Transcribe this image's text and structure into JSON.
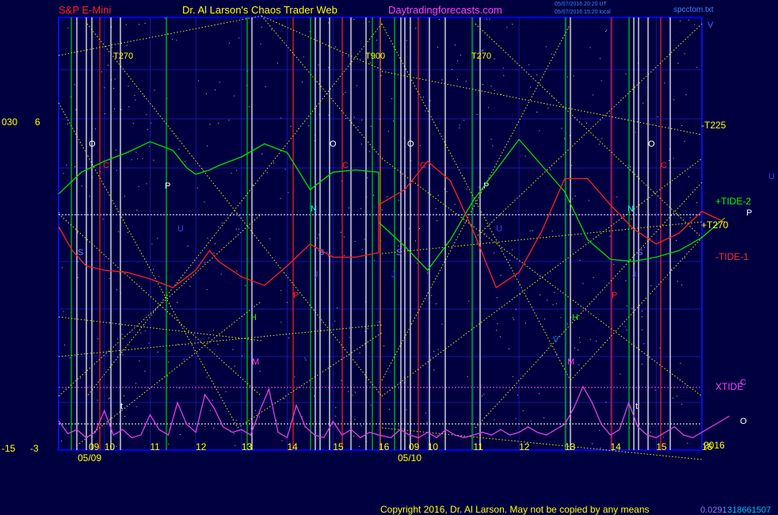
{
  "header": {
    "symbol": "S&P E-Mini",
    "title": "Dr. Al Larson's Chaos Trader Web",
    "site": "Daytradingforecasts.com",
    "timestamp_ut": "05/07/2016 20:20 UT",
    "timestamp_local": "05/07/2016 15:20 local",
    "file": "spcctom.txt"
  },
  "footer": {
    "copyright": "Copyright 2016, Dr. Al Larson. May not be copied by any means",
    "code_left": "0.0291",
    "code_right": "318661507"
  },
  "left_axis": {
    "top_a": "030",
    "top_b": "6",
    "bottom_a": "-15",
    "bottom_b": "-3"
  },
  "right_labels": {
    "v": "V",
    "u": "U",
    "p": "P",
    "o": "O",
    "c": "C",
    "t225": "-T225",
    "tide2": "+TIDE-2",
    "t270": "+T270",
    "tide1": "-TIDE-1",
    "xtide": "XTIDE",
    "year": "2016"
  },
  "x_axis": {
    "hours_day1": [
      "09",
      "10",
      "11",
      "12",
      "13",
      "14",
      "15",
      "16"
    ],
    "hours_day2": [
      "09",
      "10",
      "11",
      "12",
      "13",
      "14",
      "15",
      "16"
    ],
    "date_day1": "05/09",
    "date_day2": "05/10"
  },
  "chart_data": {
    "type": "line",
    "days": [
      "05/09",
      "05/10"
    ],
    "session_hours": [
      9,
      16
    ],
    "y_range": [
      -3,
      6
    ],
    "xtide_range": [
      -15,
      30
    ],
    "series": [
      {
        "name": "+TIDE-2",
        "color": "#00e000",
        "x": [
          9.0,
          9.5,
          10.0,
          10.5,
          11.0,
          11.5,
          11.8,
          12.0,
          12.3,
          12.5,
          13.0,
          13.5,
          14.0,
          14.5,
          15.0,
          15.5,
          16.0,
          16.0,
          16.5,
          17.0,
          17.5,
          18.0,
          18.5,
          19.0,
          19.5,
          20.0,
          20.5,
          21.0,
          21.5,
          22.0,
          22.5,
          23.0,
          23.5
        ],
        "y": [
          2.3,
          3.3,
          3.8,
          4.2,
          4.7,
          4.3,
          3.5,
          3.2,
          3.4,
          3.6,
          4.0,
          4.6,
          4.2,
          2.5,
          3.3,
          3.4,
          3.3,
          1.0,
          -0.1,
          -1.2,
          0.2,
          2.0,
          3.4,
          4.8,
          3.6,
          2.4,
          0.2,
          -0.7,
          -0.8,
          -0.6,
          -0.3,
          0.3,
          1.2
        ]
      },
      {
        "name": "-TIDE-1",
        "color": "#ff2020",
        "x": [
          9.0,
          9.3,
          9.6,
          10.0,
          10.5,
          11.0,
          11.5,
          12.0,
          12.3,
          12.5,
          13.0,
          13.5,
          14.0,
          14.5,
          15.0,
          15.5,
          16.0,
          16.0,
          16.5,
          17.0,
          17.5,
          18.0,
          18.5,
          19.0,
          19.5,
          20.0,
          20.5,
          21.0,
          21.5,
          22.0,
          22.5,
          23.0,
          23.5
        ],
        "y": [
          0.8,
          -0.3,
          -1.0,
          -1.2,
          -1.3,
          -1.6,
          -2.0,
          -1.2,
          -0.3,
          -0.8,
          -1.5,
          -1.9,
          -1.0,
          0.0,
          -0.6,
          -0.6,
          -0.4,
          1.8,
          2.5,
          3.8,
          2.9,
          0.6,
          -2.0,
          -1.3,
          0.6,
          3.0,
          3.0,
          1.8,
          0.7,
          0.0,
          0.5,
          1.5,
          1.0
        ]
      },
      {
        "name": "XTIDE",
        "color": "#e040e0",
        "x": [
          9.0,
          9.2,
          9.4,
          9.6,
          9.8,
          10.0,
          10.2,
          10.4,
          10.6,
          10.8,
          11.0,
          11.2,
          11.4,
          11.6,
          11.8,
          12.0,
          12.2,
          12.4,
          12.6,
          12.8,
          13.0,
          13.2,
          13.4,
          13.6,
          13.8,
          14.0,
          14.2,
          14.4,
          14.6,
          14.8,
          15.0,
          15.2,
          15.4,
          15.6,
          15.8,
          16.0,
          16.2,
          16.4,
          16.6,
          16.8,
          17.0,
          17.2,
          17.4,
          17.6,
          17.8,
          18.0,
          18.2,
          18.4,
          18.6,
          18.8,
          19.0,
          19.2,
          19.4,
          19.6,
          19.8,
          20.0,
          20.2,
          20.4,
          20.6,
          20.8,
          21.0,
          21.2,
          21.4,
          21.6,
          21.8,
          22.0,
          22.2,
          22.4,
          22.6,
          22.8,
          23.0,
          23.2,
          23.4,
          23.6
        ],
        "y": [
          0.6,
          -9,
          -6,
          -12,
          -8,
          8,
          -10,
          -6,
          -12,
          -10,
          5,
          -6,
          -10,
          14,
          -2,
          -8,
          20,
          10,
          -4,
          -8,
          -6,
          -10,
          8,
          24,
          -8,
          -12,
          12,
          -4,
          -10,
          -12,
          0,
          -10,
          -6,
          -12,
          -8,
          -10,
          -12,
          -6,
          -10,
          -12,
          -8,
          -12,
          -6,
          -10,
          -12,
          -10,
          -8,
          -10,
          -6,
          -10,
          -8,
          -4,
          -8,
          -10,
          -6,
          -2,
          10,
          26,
          14,
          -2,
          -10,
          -6,
          14,
          -4,
          -10,
          -12,
          -8,
          -4,
          -10,
          -12,
          -8,
          -4,
          0,
          4
        ]
      }
    ]
  }
}
